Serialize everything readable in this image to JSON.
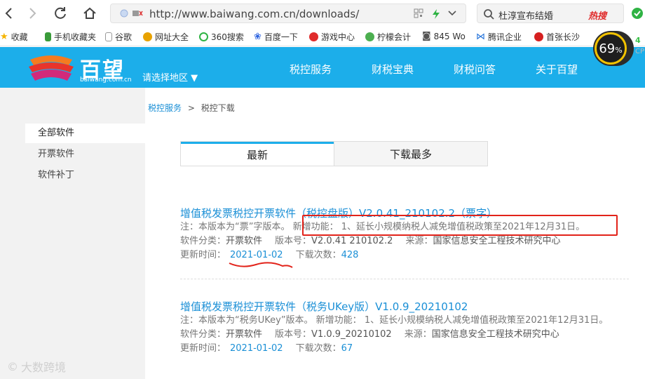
{
  "browser": {
    "url": "http://www.baiwang.com.cn/downloads/",
    "search_query": "杜淳宣布结婚",
    "search_hot": "热搜"
  },
  "bookmarks": [
    {
      "label": "收藏",
      "color": "#f5b400"
    },
    {
      "label": "手机收藏夹",
      "color": "#3a9b3a"
    },
    {
      "label": "谷歌",
      "color": "#999999"
    },
    {
      "label": "网址大全",
      "color": "#e8a200"
    },
    {
      "label": "360搜索",
      "color": "#2fb344"
    },
    {
      "label": "百度一下",
      "color": "#2d64e0"
    },
    {
      "label": "游戏中心",
      "color": "#e02b2b"
    },
    {
      "label": "柠檬会计",
      "color": "#4caf50"
    },
    {
      "label": "845 Wo",
      "color": "#555555"
    },
    {
      "label": "腾讯企业",
      "color": "#1e6fd9"
    },
    {
      "label": "首张长沙",
      "color": "#d62020"
    }
  ],
  "speed_widget": {
    "percent": "69",
    "unit": "%",
    "side_top": "4",
    "side_bottom": "CP"
  },
  "site": {
    "logo_text": "百望",
    "logo_domain": "baiwang.com.cn",
    "region": "请选择地区 ▼",
    "nav": [
      "税控服务",
      "财税宝典",
      "财税问答",
      "关于百望"
    ]
  },
  "sidebar": {
    "items": [
      {
        "label": "全部软件",
        "active": true
      },
      {
        "label": "开票软件",
        "active": false
      },
      {
        "label": "软件补丁",
        "active": false
      }
    ]
  },
  "breadcrumb": {
    "home": "税控服务",
    "sep": ">",
    "current": "税控下载"
  },
  "tabs": [
    {
      "label": "最新",
      "active": true
    },
    {
      "label": "下载最多",
      "active": false
    }
  ],
  "entries": [
    {
      "title": "增值税发票税控开票软件（税控盘版）V2.0.41_210102.2（票字）",
      "desc": "注：本版本为“票”字版本。 新增功能： 1、延长小规模纳税人减免增值税政策至2021年12月31日。",
      "category_label": "软件分类：",
      "category": "开票软件",
      "version_label": "版本号：",
      "version": "V2.0.41 210102.2",
      "source_label": "来源：",
      "source": "国家信息安全工程技术研究中心",
      "updated_label": "更新时间：",
      "updated": "2021-01-02",
      "downloads_label": "下载次数：",
      "downloads": "428"
    },
    {
      "title": "增值税发票税控开票软件（税务UKey版）V1.0.9_20210102",
      "desc": "注：本版本为“税务UKey”版本。 新增功能： 1、延长小规模纳税人减免增值税政策至2021年12月31日。",
      "category_label": "软件分类：",
      "category": "开票软件",
      "version_label": "版本号：",
      "version": "V1.0.9_20210102",
      "source_label": "来源：",
      "source": "国家信息安全工程技术研究中心",
      "updated_label": "更新时间：",
      "updated": "2021-01-02",
      "downloads_label": "下载次数：",
      "downloads": "67"
    }
  ],
  "watermark": "大数跨境",
  "colors": {
    "brand": "#1caeea",
    "link": "#1a8fd6",
    "annotation": "#e2231a"
  }
}
